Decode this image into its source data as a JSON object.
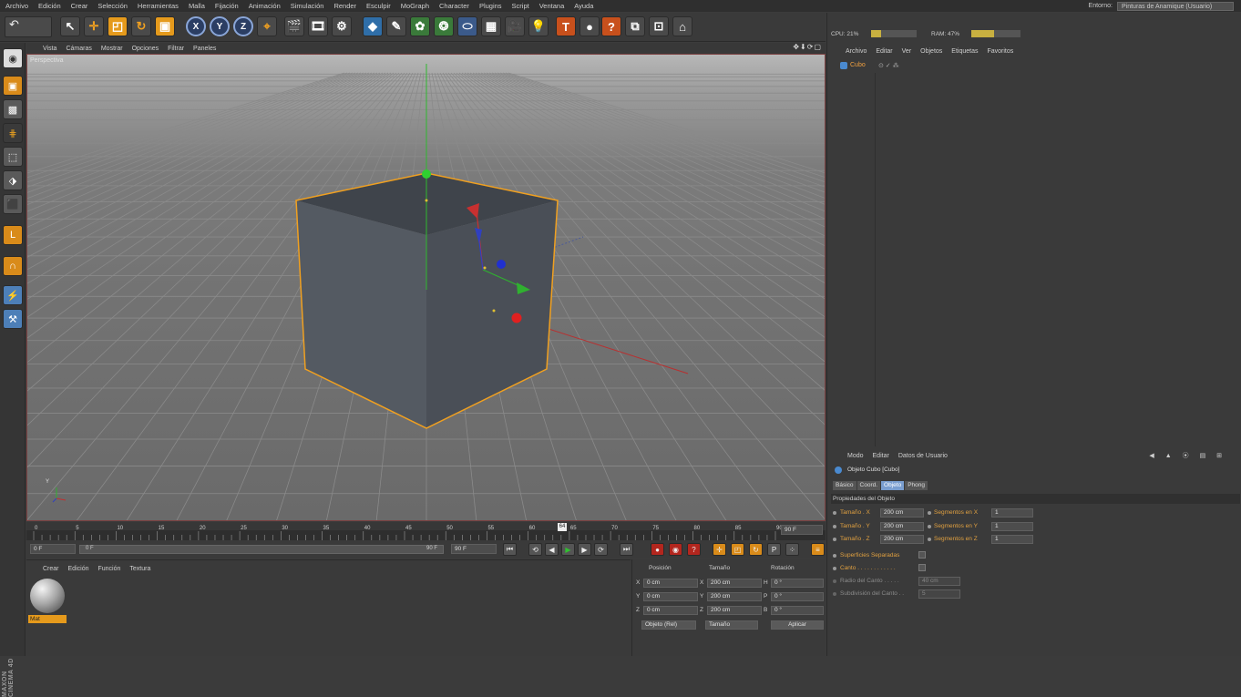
{
  "menubar": {
    "items": [
      "Archivo",
      "Edición",
      "Crear",
      "Selección",
      "Herramientas",
      "Malla",
      "Fijación",
      "Animación",
      "Simulación",
      "Render",
      "Esculpir",
      "MoGraph",
      "Character",
      "Plugins",
      "Script",
      "Ventana",
      "Ayuda"
    ],
    "entorno_label": "Entorno:",
    "entorno_value": "Pinturas de Anamique (Usuario)"
  },
  "toolbar": {
    "undo_icon": "↶",
    "x_label": "X",
    "y_label": "Y",
    "z_label": "Z"
  },
  "viewport": {
    "menu": [
      "Vista",
      "Cámaras",
      "Mostrar",
      "Opciones",
      "Filtrar",
      "Paneles"
    ],
    "label": "Perspectiva",
    "controls": "✥⬇⟳▢",
    "axis_y": "Y",
    "axis_x": "X",
    "cube_color": "#4e535a",
    "selection_color": "#f0a020"
  },
  "timeline": {
    "ticks": [
      "0",
      "5",
      "10",
      "15",
      "20",
      "25",
      "30",
      "35",
      "40",
      "45",
      "50",
      "55",
      "60",
      "65",
      "70",
      "75",
      "80",
      "85",
      "90"
    ],
    "current_frame": "64",
    "end_field": "90 F"
  },
  "transport": {
    "start_field": "0 F",
    "range_start": "0 F",
    "range_end": "90 F",
    "end_field": "90 F"
  },
  "material_manager": {
    "menu": [
      "Crear",
      "Edición",
      "Función",
      "Textura"
    ],
    "material_name": "Mat"
  },
  "coord_manager": {
    "headers": [
      "Posición",
      "Tamaño",
      "Rotación"
    ],
    "rows": [
      {
        "axis": "X",
        "pos": "0 cm",
        "size_axis": "X",
        "size": "200 cm",
        "rot_axis": "H",
        "rot": "0 °"
      },
      {
        "axis": "Y",
        "pos": "0 cm",
        "size_axis": "Y",
        "size": "200 cm",
        "rot_axis": "P",
        "rot": "0 °"
      },
      {
        "axis": "Z",
        "pos": "0 cm",
        "size_axis": "Z",
        "size": "200 cm",
        "rot_axis": "B",
        "rot": "0 °"
      }
    ],
    "mode_select": "Objeto (Rel)",
    "size_select": "Tamaño",
    "apply_button": "Aplicar"
  },
  "perf": {
    "cpu_label": "CPU: 21%",
    "cpu_value": 0.21,
    "ram_label": "RAM: 47%",
    "ram_value": 0.47
  },
  "object_manager": {
    "menu": [
      "Archivo",
      "Editar",
      "Ver",
      "Objetos",
      "Etiquetas",
      "Favoritos"
    ],
    "object_name": "Cubo"
  },
  "attributes": {
    "menu": [
      "Modo",
      "Editar",
      "Datos de Usuario"
    ],
    "object_title": "Objeto Cubo [Cubo]",
    "tabs": [
      "Básico",
      "Coord.",
      "Objeto",
      "Phong"
    ],
    "active_tab": "Objeto",
    "section": "Propiedades del Objeto",
    "size_rows": [
      {
        "label": "Tamaño . X",
        "value": "200 cm",
        "seg_label": "Segmentos en X",
        "seg_value": "1"
      },
      {
        "label": "Tamaño . Y",
        "value": "200 cm",
        "seg_label": "Segmentos en Y",
        "seg_value": "1"
      },
      {
        "label": "Tamaño . Z",
        "value": "200 cm",
        "seg_label": "Segmentos en Z",
        "seg_value": "1"
      }
    ],
    "separate_surfaces": "Superficies Separadas",
    "fillet": "Canto . . . . . . . . . . . .",
    "fillet_radius_label": "Radio del Canto . . . . .",
    "fillet_radius_value": "40 cm",
    "fillet_subdiv_label": "Subdivisión del Canto . .",
    "fillet_subdiv_value": "5"
  },
  "brand": "MAXON CINEMA 4D"
}
